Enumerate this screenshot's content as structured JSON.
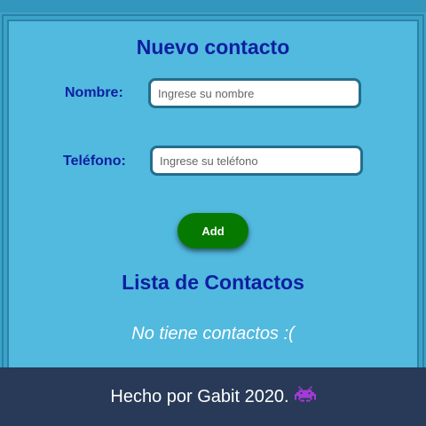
{
  "form": {
    "title": "Nuevo contacto",
    "name_label": "Nombre:",
    "name_placeholder": "Ingrese su nombre",
    "name_value": "",
    "phone_label": "Teléfono:",
    "phone_placeholder": "Ingrese su teléfono",
    "phone_value": "",
    "add_label": "Add"
  },
  "list": {
    "title": "Lista de Contactos",
    "empty_message": "No tiene contactos :("
  },
  "footer": {
    "text": "Hecho por Gabit 2020.",
    "icon": "space-invader-icon"
  },
  "colors": {
    "card_background": "#52b9df",
    "heading": "#0d1fa0",
    "add_button": "#067a00",
    "footer_background": "#283a57"
  }
}
